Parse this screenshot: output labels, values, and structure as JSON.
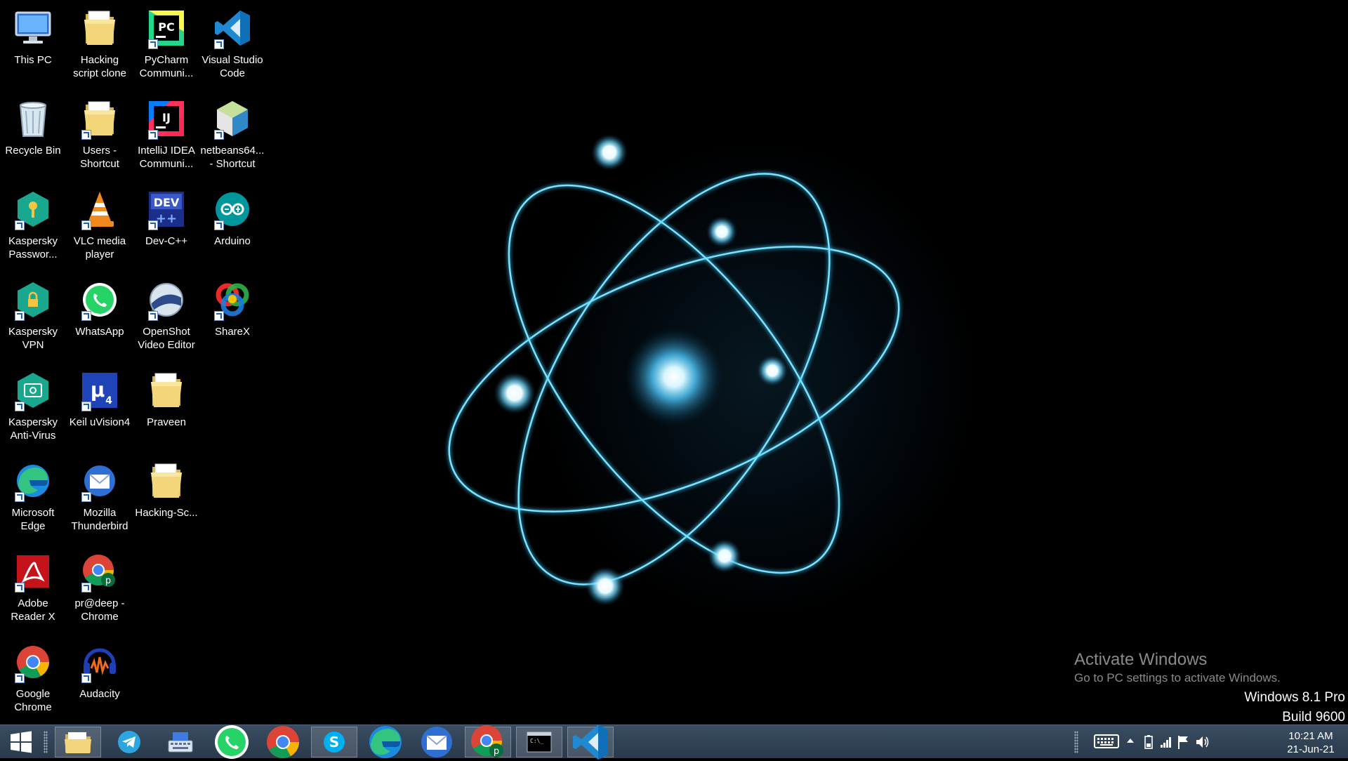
{
  "desktop_icons": [
    {
      "label": "This PC",
      "icon": "this-pc-icon",
      "shortcut": false
    },
    {
      "label": "Hacking\nscript clone",
      "icon": "folder-icon",
      "shortcut": false
    },
    {
      "label": "PyCharm\nCommuni...",
      "icon": "pycharm-icon",
      "shortcut": true
    },
    {
      "label": "Visual Studio\nCode",
      "icon": "vscode-icon",
      "shortcut": true
    },
    {
      "label": "Recycle Bin",
      "icon": "recycle-bin-icon",
      "shortcut": false
    },
    {
      "label": "Users -\nShortcut",
      "icon": "folder-icon",
      "shortcut": true
    },
    {
      "label": "IntelliJ IDEA\nCommuni...",
      "icon": "intellij-icon",
      "shortcut": true
    },
    {
      "label": "netbeans64...\n- Shortcut",
      "icon": "netbeans-icon",
      "shortcut": true
    },
    {
      "label": "Kaspersky\nPasswor...",
      "icon": "kaspersky-password-icon",
      "shortcut": true
    },
    {
      "label": "VLC media\nplayer",
      "icon": "vlc-icon",
      "shortcut": true
    },
    {
      "label": "Dev-C++",
      "icon": "devcpp-icon",
      "shortcut": true
    },
    {
      "label": "Arduino",
      "icon": "arduino-icon",
      "shortcut": true
    },
    {
      "label": "Kaspersky\nVPN",
      "icon": "kaspersky-vpn-icon",
      "shortcut": true
    },
    {
      "label": "WhatsApp",
      "icon": "whatsapp-icon",
      "shortcut": true
    },
    {
      "label": "OpenShot\nVideo Editor",
      "icon": "openshot-icon",
      "shortcut": true
    },
    {
      "label": "ShareX",
      "icon": "sharex-icon",
      "shortcut": true
    },
    {
      "label": "Kaspersky\nAnti-Virus",
      "icon": "kaspersky-antivirus-icon",
      "shortcut": true
    },
    {
      "label": "Keil uVision4",
      "icon": "keil-icon",
      "shortcut": true
    },
    {
      "label": "Praveen",
      "icon": "folder-icon",
      "shortcut": false
    },
    {
      "label": "Microsoft\nEdge",
      "icon": "edge-icon",
      "shortcut": true
    },
    {
      "label": "Mozilla\nThunderbird",
      "icon": "thunderbird-icon",
      "shortcut": true
    },
    {
      "label": "Hacking-Sc...",
      "icon": "folder-icon",
      "shortcut": false
    },
    {
      "label": "Adobe\nReader X",
      "icon": "adobe-reader-icon",
      "shortcut": true
    },
    {
      "label": "pr@deep -\nChrome",
      "icon": "chrome-profile-icon",
      "shortcut": true
    },
    {
      "label": "Google\nChrome",
      "icon": "chrome-icon",
      "shortcut": true
    },
    {
      "label": "Audacity",
      "icon": "audacity-icon",
      "shortcut": true
    }
  ],
  "watermark": {
    "title": "Activate Windows",
    "subtitle": "Go to PC settings to activate Windows."
  },
  "os_edition": {
    "line1": "Windows 8.1 Pro",
    "line2": "Build 9600"
  },
  "taskbar": {
    "start_icon": "windows-logo-icon",
    "pinned": [
      {
        "icon": "file-explorer-icon",
        "active": true
      },
      {
        "icon": "telegram-icon",
        "active": false
      },
      {
        "icon": "on-screen-keyboard-icon",
        "active": false
      },
      {
        "icon": "whatsapp-icon",
        "active": false
      },
      {
        "icon": "chrome-icon",
        "active": false
      },
      {
        "icon": "skype-icon",
        "active": true
      },
      {
        "icon": "edge-icon",
        "active": false
      },
      {
        "icon": "thunderbird-icon",
        "active": false
      },
      {
        "icon": "chrome-profile-icon",
        "active": true
      },
      {
        "icon": "command-prompt-icon",
        "active": true
      },
      {
        "icon": "vscode-icon",
        "active": true
      }
    ],
    "tray_icons": [
      "keyboard-icon",
      "show-hidden-icons-icon",
      "battery-icon",
      "network-icon",
      "action-center-flag-icon",
      "volume-icon"
    ],
    "clock": {
      "time": "10:21 AM",
      "date": "21-Jun-21"
    }
  },
  "colors": {
    "taskbar": "#2f4154",
    "wallpaper_glow": "#5fd3ff",
    "watermark_text": "#8a8a8a"
  }
}
